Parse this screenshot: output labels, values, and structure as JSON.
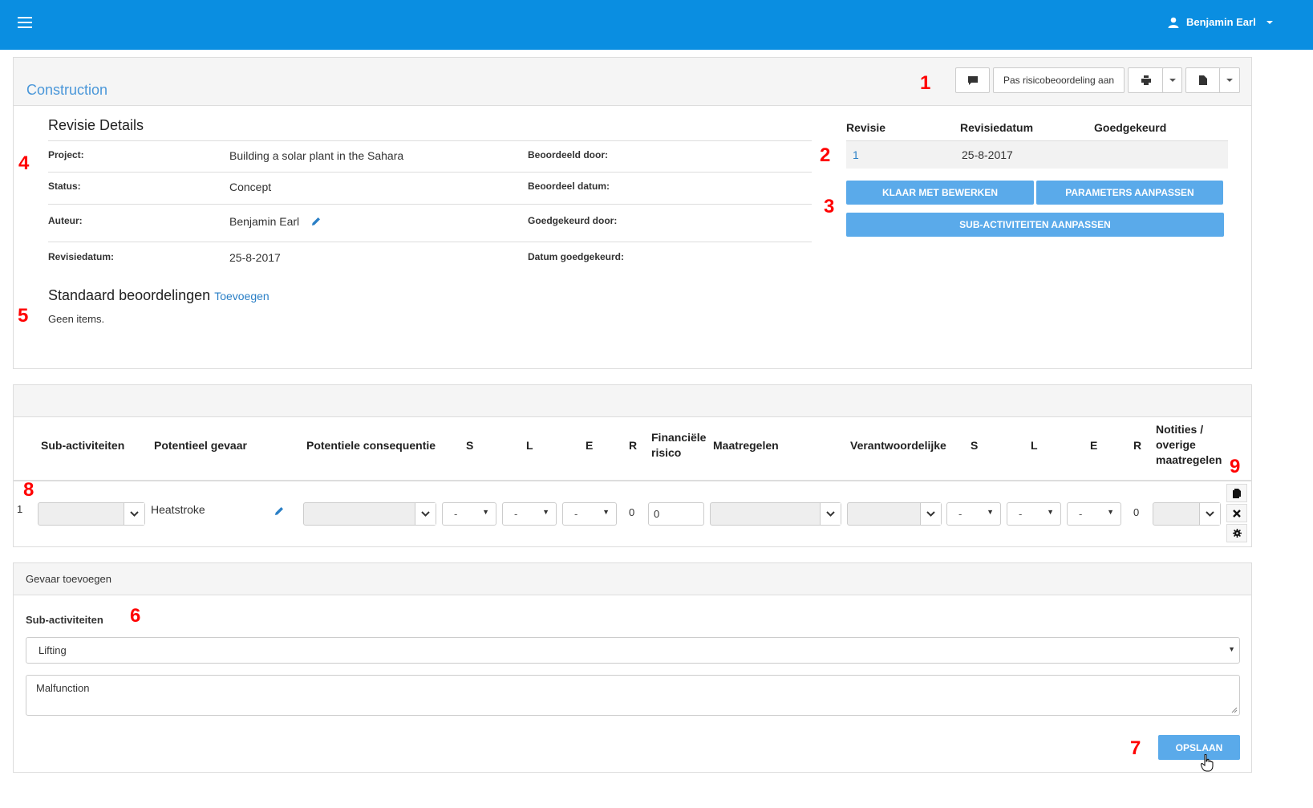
{
  "header": {
    "user_name": "Benjamin Earl"
  },
  "panel1": {
    "title": "Construction",
    "adjust_button": "Pas risicobeoordeling aan",
    "revisie_details_title": "Revisie Details",
    "fields": {
      "project_label": "Project:",
      "project_value": "Building a solar plant in the Sahara",
      "beoordeeld_door_label": "Beoordeeld door:",
      "status_label": "Status:",
      "status_value": "Concept",
      "beoordeel_datum_label": "Beoordeel datum:",
      "auteur_label": "Auteur:",
      "auteur_value": "Benjamin Earl",
      "goedgekeurd_door_label": "Goedgekeurd door:",
      "revisiedatum_label": "Revisiedatum:",
      "revisiedatum_value": "25-8-2017",
      "datum_goedgekeurd_label": "Datum goedgekeurd:"
    },
    "revision_table": {
      "headers": [
        "Revisie",
        "Revisiedatum",
        "Goedgekeurd"
      ],
      "row": {
        "revisie": "1",
        "revisiedatum": "25-8-2017",
        "goedgekeurd": ""
      }
    },
    "buttons": {
      "klaar": "KLAAR MET BEWERKEN",
      "parameters": "PARAMETERS AANPASSEN",
      "sub": "SUB-ACTIVITEITEN AANPASSEN"
    },
    "standard_title": "Standaard beoordelingen",
    "standard_add": "Toevoegen",
    "standard_empty": "Geen items."
  },
  "table": {
    "headers": {
      "sub_activiteiten": "Sub-activiteiten",
      "potentieel_gevaar": "Potentieel gevaar",
      "potentiele_consequentie": "Potentiele consequentie",
      "s1": "S",
      "l1": "L",
      "e1": "E",
      "r1": "R",
      "financiele_1": "Financiële",
      "financiele_2": "risico",
      "maatregelen": "Maatregelen",
      "verantwoordelijke": "Verantwoordelijke",
      "s2": "S",
      "l2": "L",
      "e2": "E",
      "r2": "R",
      "notities_1": "Notities /",
      "notities_2": "overige",
      "notities_3": "maatregelen"
    },
    "row": {
      "num": "1",
      "hazard": "Heatstroke",
      "s1": "-",
      "l1": "-",
      "e1": "-",
      "r1": "0",
      "financial": "0",
      "s2": "-",
      "l2": "-",
      "e2": "-",
      "r2": "0"
    }
  },
  "add_hazard": {
    "title": "Gevaar toevoegen",
    "sub_label": "Sub-activiteiten",
    "selected_sub": "Lifting",
    "textarea_value": "Malfunction",
    "save_button": "OPSLAAN"
  },
  "annotations": {
    "a1": "1",
    "a2": "2",
    "a3": "3",
    "a4": "4",
    "a5": "5",
    "a6": "6",
    "a7": "7",
    "a8": "8",
    "a9": "9"
  },
  "colors": {
    "header_bg": "#0a8ee1",
    "primary_button": "#5aaaea",
    "link": "#2a7fc6",
    "annotation": "#ff0000"
  }
}
